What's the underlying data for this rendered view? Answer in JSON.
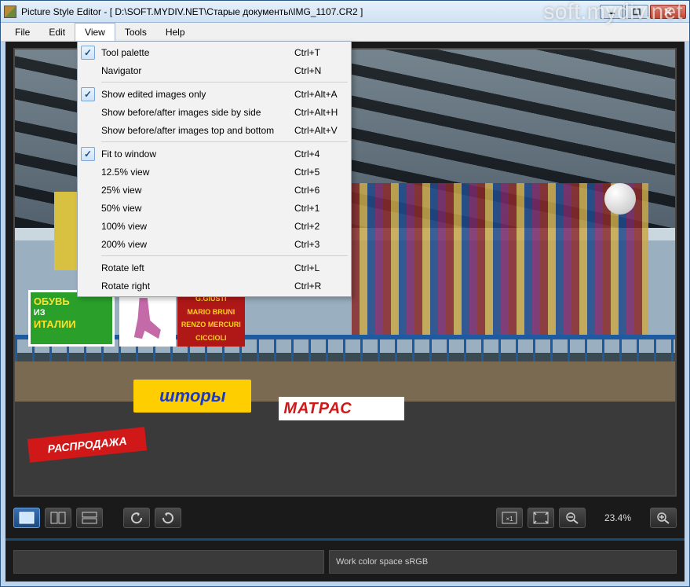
{
  "window": {
    "title": "Picture Style Editor - [ D:\\SOFT.MYDIV.NET\\Старые документы\\IMG_1107.CR2 ]"
  },
  "menubar": {
    "items": [
      "File",
      "Edit",
      "View",
      "Tools",
      "Help"
    ],
    "active_index": 2
  },
  "view_menu": {
    "groups": [
      [
        {
          "label": "Tool palette",
          "shortcut": "Ctrl+T",
          "checked": true
        },
        {
          "label": "Navigator",
          "shortcut": "Ctrl+N",
          "checked": false
        }
      ],
      [
        {
          "label": "Show edited images only",
          "shortcut": "Ctrl+Alt+A",
          "checked": true
        },
        {
          "label": "Show before/after images side by side",
          "shortcut": "Ctrl+Alt+H",
          "checked": false
        },
        {
          "label": "Show before/after images top and bottom",
          "shortcut": "Ctrl+Alt+V",
          "checked": false
        }
      ],
      [
        {
          "label": "Fit to window",
          "shortcut": "Ctrl+4",
          "checked": true
        },
        {
          "label": "12.5% view",
          "shortcut": "Ctrl+5",
          "checked": false
        },
        {
          "label": "25% view",
          "shortcut": "Ctrl+6",
          "checked": false
        },
        {
          "label": "50% view",
          "shortcut": "Ctrl+1",
          "checked": false
        },
        {
          "label": "100% view",
          "shortcut": "Ctrl+2",
          "checked": false
        },
        {
          "label": "200% view",
          "shortcut": "Ctrl+3",
          "checked": false
        }
      ],
      [
        {
          "label": "Rotate left",
          "shortcut": "Ctrl+L",
          "checked": false
        },
        {
          "label": "Rotate right",
          "shortcut": "Ctrl+R",
          "checked": false
        }
      ]
    ]
  },
  "toolbar": {
    "zoom_percent": "23.4%"
  },
  "status": {
    "work_color_space": "Work color space  sRGB"
  },
  "photo_signs": {
    "green_top": "ОБУВЬ",
    "green_mid": "ИЗ",
    "green_bot": "ИТАЛИИ",
    "red_l1": "G.GIUSTI",
    "red_l2": "MARIO BRUNI",
    "red_l3": "RENZO MERCURI",
    "red_l4": "CICCIOLI",
    "shtory": "шторы",
    "rasp": "РАСПРОДАЖА",
    "matr": "МАТРАС"
  },
  "watermark": "soft.mydiv.net"
}
